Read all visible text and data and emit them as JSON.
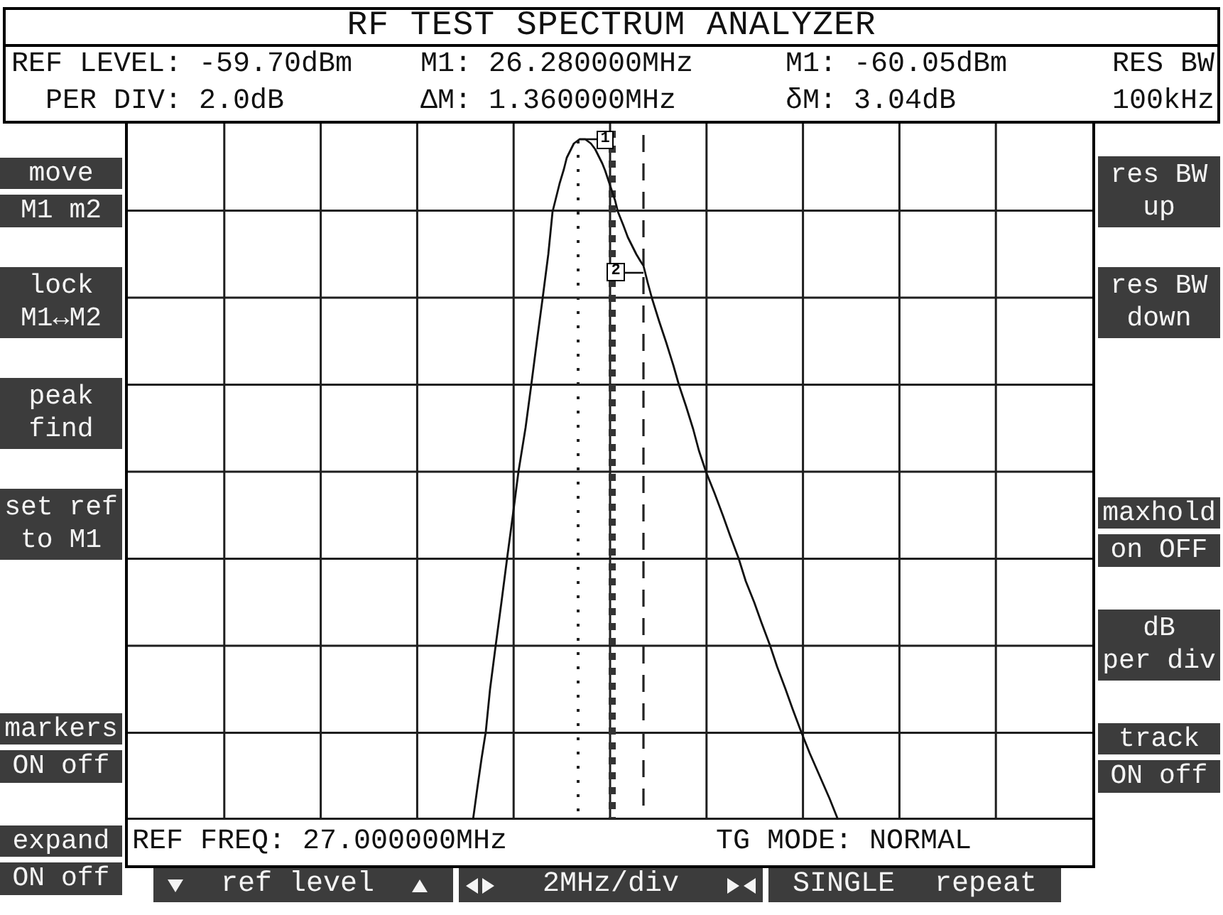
{
  "window": {
    "title": "RF TEST SPECTRUM ANALYZER"
  },
  "readout_columns": [
    {
      "items": [
        {
          "label": "REF LEVEL:",
          "value": "-59.70dBm"
        },
        {
          "label": "PER DIV:",
          "value": "2.0dB"
        }
      ]
    },
    {
      "items": [
        {
          "label": "M1:",
          "value": "26.280000MHz"
        },
        {
          "label": "ΔM:",
          "value": "1.360000MHz"
        }
      ]
    },
    {
      "items": [
        {
          "label": "M1:",
          "value": "-60.05dBm"
        },
        {
          "label": "δM:",
          "value": "3.04dB"
        }
      ]
    }
  ],
  "resolution_bandwidth": {
    "label": "RES BW",
    "value": "100kHz"
  },
  "left_softkeys": {
    "top": [
      {
        "kind": "toggle",
        "label": "move",
        "value": "M1 m2"
      },
      {
        "kind": "key",
        "lines": [
          "lock",
          "M1↔M2"
        ]
      },
      {
        "kind": "key",
        "lines": [
          "peak",
          "find"
        ]
      },
      {
        "kind": "key",
        "lines": [
          "set ref",
          "to M1"
        ]
      }
    ],
    "bottom": [
      {
        "kind": "toggle",
        "label": "markers",
        "value": "ON off"
      },
      {
        "kind": "toggle",
        "label": "expand",
        "value": "ON off"
      }
    ]
  },
  "right_softkeys": {
    "top": [
      {
        "kind": "key",
        "lines": [
          "res BW",
          "up"
        ]
      },
      {
        "kind": "key",
        "lines": [
          "res BW",
          "down"
        ]
      }
    ],
    "bottom": [
      {
        "kind": "toggle",
        "label": "maxhold",
        "value": "on OFF"
      },
      {
        "kind": "key",
        "lines": [
          "dB",
          "per div"
        ]
      },
      {
        "kind": "toggle",
        "label": "track",
        "value": "ON off"
      }
    ]
  },
  "plot": {
    "markers": [
      {
        "label": "1"
      },
      {
        "label": "2"
      }
    ],
    "footer": [
      "REF FREQ: 27.000000MHz",
      "TG MODE: NORMAL"
    ]
  },
  "bottom_keys": [
    {
      "kind": "level",
      "label": "ref level"
    },
    {
      "kind": "span",
      "label": "2MHz/div"
    },
    {
      "kind": "sweep",
      "label": "SINGLE repeat"
    }
  ]
}
